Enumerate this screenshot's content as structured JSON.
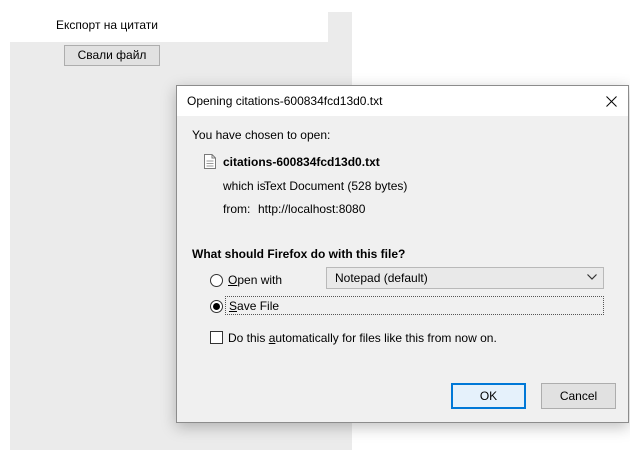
{
  "page": {
    "title": "Експорт на цитати",
    "download_button": "Свали файл"
  },
  "dialog": {
    "title": "Opening citations-600834fcd13d0.txt",
    "chosen_text": "You have chosen to open:",
    "file_name": "citations-600834fcd13d0.txt",
    "which_label": "which is:",
    "which_value": "Text Document (528 bytes)",
    "from_label": "from:",
    "from_value": "http://localhost:8080",
    "question": "What should Firefox do with this file?",
    "open_with": {
      "accel": "O",
      "rest": "pen with",
      "selected": false,
      "app_value": "Notepad (default)"
    },
    "save_file": {
      "accel": "S",
      "rest": "ave File",
      "selected": true
    },
    "auto": {
      "before": "Do this ",
      "accel": "a",
      "after": "utomatically for files like this from now on.",
      "checked": false
    },
    "ok_label": "OK",
    "cancel_label": "Cancel"
  },
  "colors": {
    "dialog_bg": "#f0f0f0",
    "ok_border": "#0078d7",
    "page_panel": "#ebebeb"
  },
  "icons": {
    "close": "close-icon",
    "file": "document-icon",
    "dropdown": "chevron-down-icon"
  }
}
